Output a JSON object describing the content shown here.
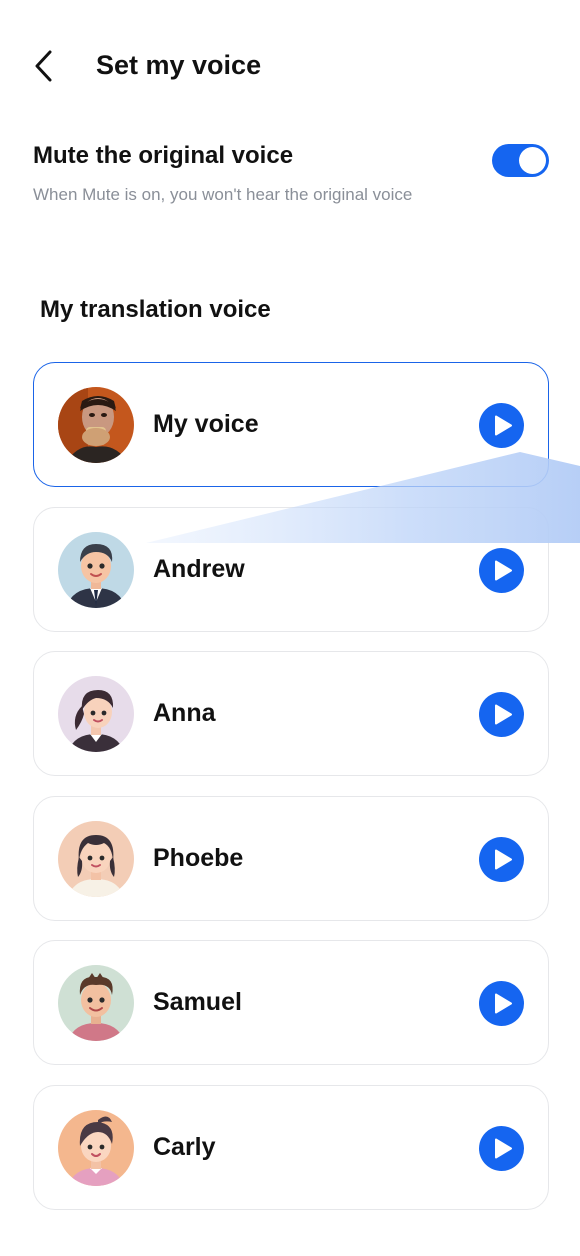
{
  "header": {
    "title": "Set my voice",
    "back_icon": "chevron-left-icon"
  },
  "mute": {
    "title": "Mute the original voice",
    "description": "When Mute is on, you won't hear the original voice",
    "enabled": true,
    "toggle_color": "#1565f0"
  },
  "translation": {
    "section_title": "My translation voice",
    "selected_index": 0,
    "voices": [
      {
        "name": "My voice",
        "avatar": "user-photo-avatar",
        "play_icon": "play-icon"
      },
      {
        "name": "Andrew",
        "avatar": "cartoon-man-suit-avatar",
        "play_icon": "play-icon"
      },
      {
        "name": "Anna",
        "avatar": "cartoon-woman-ponytail-avatar",
        "play_icon": "play-icon"
      },
      {
        "name": "Phoebe",
        "avatar": "cartoon-woman-avatar",
        "play_icon": "play-icon"
      },
      {
        "name": "Samuel",
        "avatar": "cartoon-man-avatar",
        "play_icon": "play-icon"
      },
      {
        "name": "Carly",
        "avatar": "cartoon-girl-avatar",
        "play_icon": "play-icon"
      }
    ]
  },
  "colors": {
    "accent": "#1565f0",
    "selected_border": "#1a64e8",
    "card_border": "#e6e7ea",
    "muted_text": "#8a8f98"
  }
}
